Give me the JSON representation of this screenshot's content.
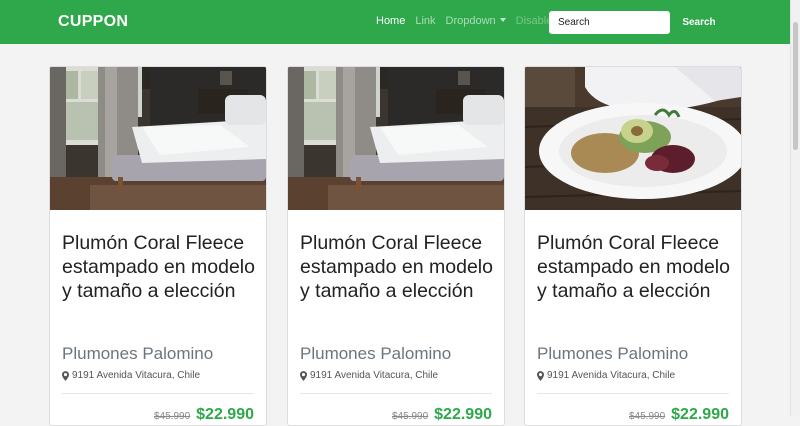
{
  "navbar": {
    "brand": "CUPPON",
    "links": [
      {
        "label": "Home"
      },
      {
        "label": "Link"
      },
      {
        "label": "Dropdown"
      },
      {
        "label": "Disabled"
      }
    ],
    "search": {
      "placeholder": "Search",
      "button_label": "Search"
    }
  },
  "colors": {
    "brand_green": "#2ea84a",
    "price_green": "#2ea84a",
    "subtitle_gray": "#6c757d"
  },
  "cards": [
    {
      "image": "bedroom-photo",
      "title": "Plumón Coral Fleece estampado en modelo y tamaño a elección",
      "subtitle": "Plumones Palomino",
      "address": "9191 Avenida Vitacura, Chile",
      "old_price": "$45.990",
      "price": "$22.990"
    },
    {
      "image": "bedroom-photo",
      "title": "Plumón Coral Fleece estampado en modelo y tamaño a elección",
      "subtitle": "Plumones Palomino",
      "address": "9191 Avenida Vitacura, Chile",
      "old_price": "$45.990",
      "price": "$22.990"
    },
    {
      "image": "salad-bowl-photo",
      "title": "Plumón Coral Fleece estampado en modelo y tamaño a elección",
      "subtitle": "Plumones Palomino",
      "address": "9191 Avenida Vitacura, Chile",
      "old_price": "$45.990",
      "price": "$22.990"
    }
  ]
}
